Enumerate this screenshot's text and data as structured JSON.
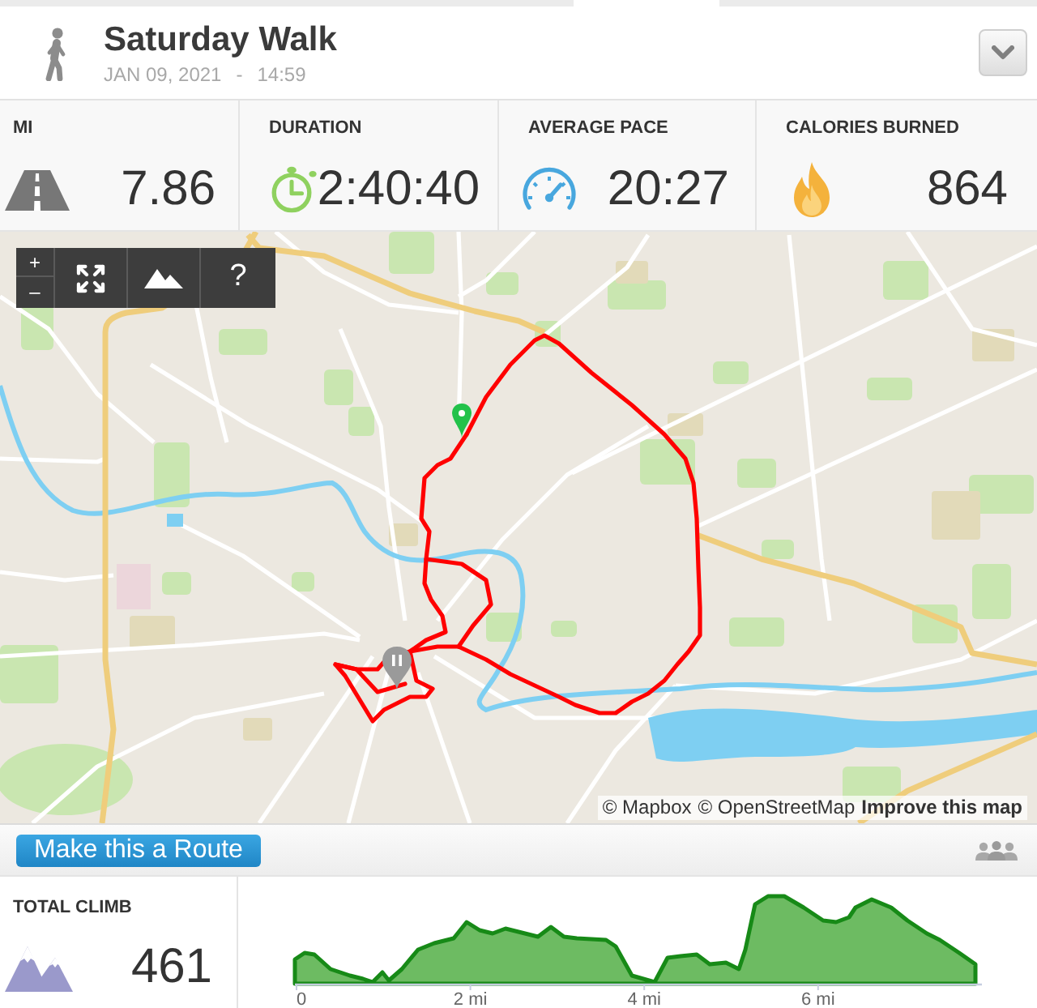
{
  "header": {
    "title": "Saturday Walk",
    "date": "JAN 09, 2021",
    "separator": "-",
    "time": "14:59"
  },
  "stats": [
    {
      "kind": "distance",
      "label": "MI",
      "value": "7.86"
    },
    {
      "kind": "duration",
      "label": "DURATION",
      "value": "2:40:40"
    },
    {
      "kind": "pace",
      "label": "AVERAGE PACE",
      "value": "20:27"
    },
    {
      "kind": "calories",
      "label": "CALORIES BURNED",
      "value": "864"
    }
  ],
  "map": {
    "controls": {
      "zoom_in": "+",
      "zoom_out": "–",
      "help": "?"
    },
    "attribution": [
      "© Mapbox",
      "© OpenStreetMap"
    ],
    "improve_link": "Improve this map"
  },
  "route_bar": {
    "button": "Make this a Route"
  },
  "climb": {
    "label": "TOTAL CLIMB",
    "value": "461"
  },
  "elevation": {
    "x_labels": [
      "0",
      "2 mi",
      "4 mi",
      "6 mi"
    ]
  }
}
